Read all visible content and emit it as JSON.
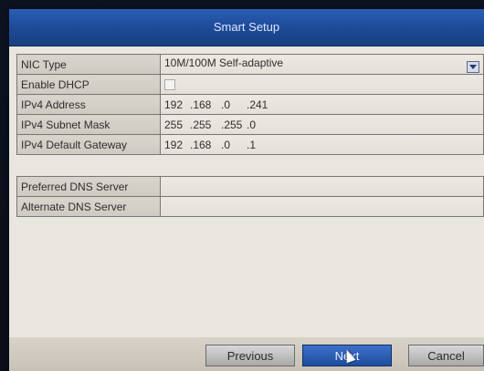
{
  "dialog": {
    "title": "Smart Setup"
  },
  "network_fields": [
    {
      "label": "NIC Type",
      "value": "10M/100M Self-adaptive"
    },
    {
      "label": "Enable DHCP",
      "checked": false
    },
    {
      "label": "IPv4 Address",
      "octets": [
        "192",
        ".168",
        ".0",
        ".241"
      ]
    },
    {
      "label": "IPv4 Subnet Mask",
      "octets": [
        "255",
        ".255",
        ".255",
        ".0"
      ]
    },
    {
      "label": "IPv4 Default Gateway",
      "octets": [
        "192",
        ".168",
        ".0",
        ".1"
      ]
    }
  ],
  "dns_fields": [
    {
      "label": "Preferred DNS Server",
      "value": ""
    },
    {
      "label": "Alternate DNS Server",
      "value": ""
    }
  ],
  "buttons": {
    "previous": "Previous",
    "next": "Next",
    "cancel": "Cancel"
  },
  "colors": {
    "title_bar": "#1e4b99",
    "accent": "#1e4e9f",
    "panel": "#e9e6df"
  }
}
